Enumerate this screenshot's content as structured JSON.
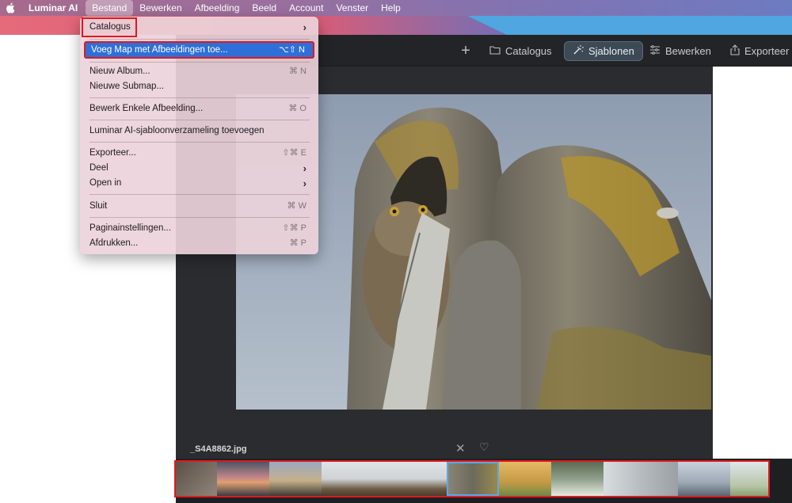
{
  "menubar": {
    "apple": "",
    "app_name": "Luminar AI",
    "items": [
      "Bestand",
      "Bewerken",
      "Afbeelding",
      "Beeld",
      "Account",
      "Venster",
      "Help"
    ]
  },
  "dropdown": {
    "catalogus": "Catalogus",
    "voeg_map": "Voeg Map met Afbeeldingen toe...",
    "voeg_map_shortcut": "⌥⇧ N",
    "nieuw_album": "Nieuw Album...",
    "nieuw_album_shortcut": "⌘ N",
    "nieuwe_submap": "Nieuwe Submap...",
    "bewerk_enkele": "Bewerk Enkele Afbeelding...",
    "bewerk_enkele_shortcut": "⌘ O",
    "sjabloon": "Luminar AI-sjabloonverzameling toevoegen",
    "exporteer": "Exporteer...",
    "exporteer_shortcut": "⇧⌘ E",
    "deel": "Deel",
    "open_in": "Open in",
    "sluit": "Sluit",
    "sluit_shortcut": "⌘ W",
    "pagina": "Paginainstellingen...",
    "pagina_shortcut": "⇧⌘ P",
    "afdrukken": "Afdrukken...",
    "afdrukken_shortcut": "⌘ P"
  },
  "toolbar": {
    "catalogus": "Catalogus",
    "sjablonen": "Sjablonen",
    "bewerken": "Bewerken",
    "exporteer": "Exporteer"
  },
  "image": {
    "filename": "_S4A8862.jpg"
  },
  "colors": {
    "highlight": "#2f6fd8",
    "annotation": "#e0181f",
    "window_bg": "#2b2c2f"
  },
  "icons": {
    "folder": "folder-icon",
    "wand": "wand-icon",
    "sliders": "sliders-icon",
    "share": "share-icon",
    "close": "close-icon",
    "heart": "heart-icon"
  }
}
